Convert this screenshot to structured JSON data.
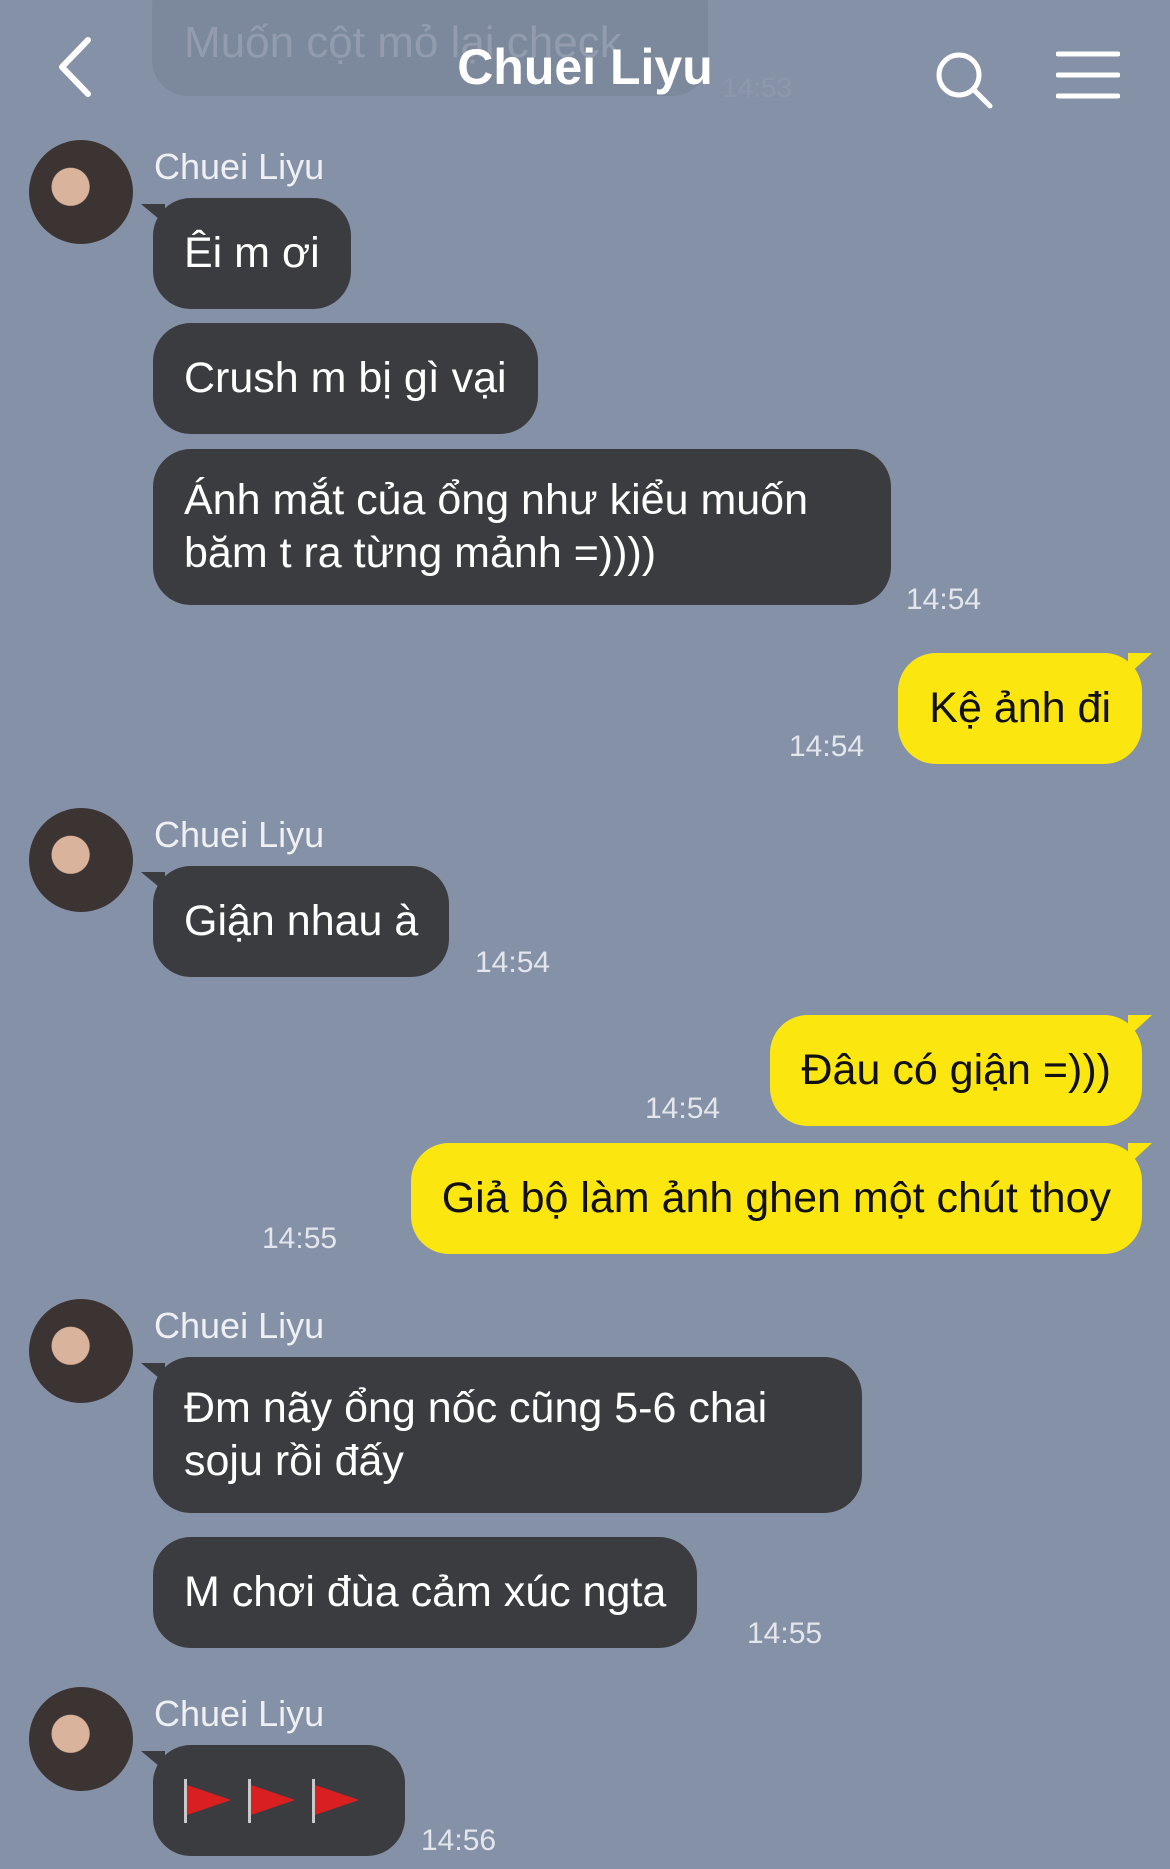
{
  "header": {
    "title": "Chuei Liyu",
    "ghost_message": "Muốn cột mỏ lại check",
    "ghost_time": "14:53"
  },
  "messages": [
    {
      "sender": "Chuei Liyu"
    },
    {
      "text": "Êi m ơi"
    },
    {
      "text": "Crush m bị gì vại"
    },
    {
      "line1": "Ánh mắt của ổng như kiểu muốn",
      "line2": "băm t ra từng mảnh =))))",
      "time": "14:54"
    },
    {
      "text": "Kệ ảnh đi",
      "time": "14:54"
    },
    {
      "sender": "Chuei Liyu",
      "text": "Giận nhau à",
      "time": "14:54"
    },
    {
      "text": "Đâu có giận =)))",
      "time": "14:54"
    },
    {
      "text": "Giả bộ làm ảnh ghen một chút thoy",
      "time": "14:55"
    },
    {
      "sender": "Chuei Liyu",
      "line1": "Đm nãy ổng nốc cũng 5-6 chai",
      "line2": "soju rồi đấy"
    },
    {
      "text": "M chơi đùa cảm xúc ngta",
      "time": "14:55"
    },
    {
      "sender": "Chuei Liyu",
      "flag_count": 3,
      "time": "14:56"
    }
  ],
  "icons": {
    "back": "chevron-left-icon",
    "search": "search-icon",
    "menu": "hamburger-menu-icon",
    "flag": "red-triangular-flag"
  },
  "colors": {
    "background": "#8591a6",
    "incoming_bubble": "#3b3c3f",
    "outgoing_bubble": "#fbe70f"
  }
}
